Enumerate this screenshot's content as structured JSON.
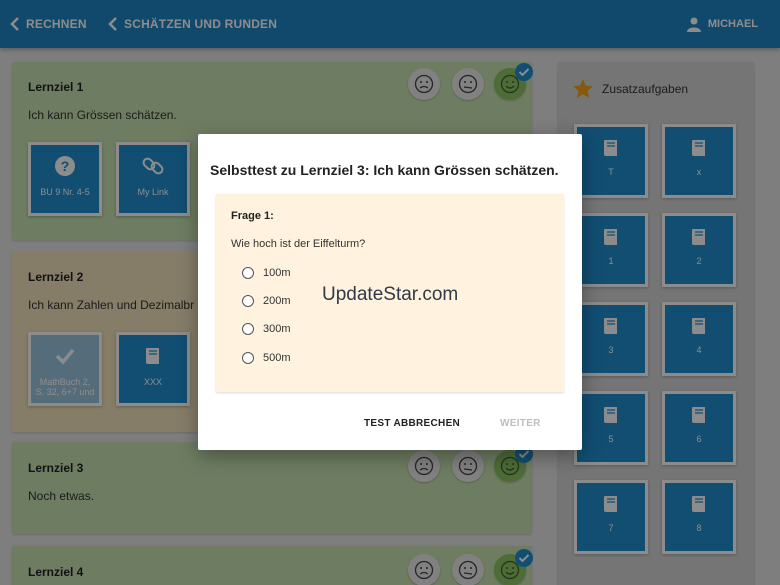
{
  "header": {
    "crumbs": [
      "RECHNEN",
      "SCHÄTZEN UND RUNDEN"
    ],
    "user": "MICHAEL"
  },
  "goals": [
    {
      "title": "Lernziel 1",
      "text": "Ich kann Grössen schätzen.",
      "tiles": [
        {
          "icon": "question-icon",
          "label": "BU 9 Nr. 4-5"
        },
        {
          "icon": "link-icon",
          "label": "My Link"
        }
      ]
    },
    {
      "title": "Lernziel 2",
      "text": "Ich kann Zahlen und Dezimalbr",
      "tiles": [
        {
          "icon": "check-icon",
          "label": "MathBuch 2, S. 32, 6+7 und"
        },
        {
          "icon": "book-icon",
          "label": "XXX"
        }
      ]
    },
    {
      "title": "Lernziel 3",
      "text": "Noch etwas."
    },
    {
      "title": "Lernziel 4"
    }
  ],
  "sidebar": {
    "title": "Zusatzaufgaben",
    "tiles": [
      "T",
      "x",
      "1",
      "2",
      "3",
      "4",
      "5",
      "6",
      "7",
      "8"
    ]
  },
  "dialog": {
    "title": "Selbsttest zu Lernziel 3: Ich kann Grössen schätzen.",
    "question_label": "Frage 1:",
    "question": "Wie hoch ist der Eiffelturm?",
    "options": [
      "100m",
      "200m",
      "300m",
      "500m"
    ],
    "cancel": "TEST ABBRECHEN",
    "next": "WEITER"
  },
  "watermark": "UpdateStar.com",
  "colors": {
    "primary": "#1f86c5",
    "goal_green": "#c9e3b2",
    "goal_yellow": "#f3e3bd",
    "question_bg": "#fff3df"
  }
}
